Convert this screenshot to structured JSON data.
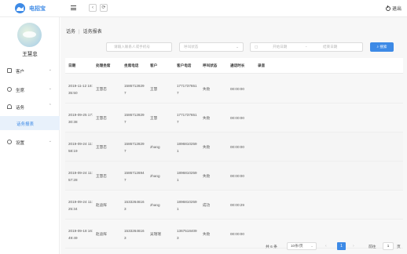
{
  "app": {
    "logo_text": "电招宝",
    "logout_label": "退出"
  },
  "toolbar": {
    "back_glyph": "‹",
    "refresh_glyph": "⟳"
  },
  "user": {
    "name": "王慧忠"
  },
  "sidebar": {
    "items": [
      {
        "label": "客户",
        "icon": "user-icon",
        "chevron": "⌄"
      },
      {
        "label": "坐席",
        "icon": "person-icon",
        "chevron": "⌄"
      },
      {
        "label": "话务",
        "icon": "headset-icon",
        "chevron": "⌃"
      },
      {
        "label": "设置",
        "icon": "gear-icon",
        "chevron": "⌄"
      }
    ],
    "active_sub": "话务报表"
  },
  "breadcrumb": {
    "parent": "话务",
    "separator": "|",
    "current": "话务报表"
  },
  "filters": {
    "keyword_placeholder": "请输入联系人或手机号",
    "status_placeholder": "呼叫状态",
    "start_placeholder": "开始日期",
    "range_sep": "-",
    "end_placeholder": "结束日期",
    "search_label": "搜索"
  },
  "table": {
    "columns": [
      "日期",
      "处理坐席",
      "坐席电话",
      "客户",
      "客户电话",
      "呼叫状态",
      "通话时长",
      "录音"
    ],
    "rows": [
      {
        "date": "2019-11-12 18:35:50",
        "agent": "王慧忠",
        "agent_phone": "15867128297",
        "customer": "王慧",
        "customer_phone": "17717376517",
        "status": "失败",
        "duration": "00:00:00",
        "recording": ""
      },
      {
        "date": "2019-09-25 17:30:38",
        "agent": "王慧忠",
        "agent_phone": "15867128297",
        "customer": "王慧",
        "customer_phone": "17717376517",
        "status": "失败",
        "duration": "00:00:00",
        "recording": ""
      },
      {
        "date": "2019-09-24 11:58:19",
        "agent": "王慧忠",
        "agent_phone": "15867128297",
        "customer": "zhang",
        "customer_phone": "18968102591",
        "status": "失败",
        "duration": "00:00:00",
        "recording": ""
      },
      {
        "date": "2019-09-24 11:57:28",
        "agent": "王慧忠",
        "agent_phone": "15867126947",
        "customer": "zhang",
        "customer_phone": "18968102591",
        "status": "失败",
        "duration": "00:00:00",
        "recording": ""
      },
      {
        "date": "2019-09-24 11:25:34",
        "agent": "赵迪辉",
        "agent_phone": "15332646163",
        "customer": "zhang",
        "customer_phone": "18968102591",
        "status": "成功",
        "duration": "00:00:29",
        "recording": ""
      },
      {
        "date": "2019-09-18 16:49:49",
        "agent": "赵迪辉",
        "agent_phone": "15332646163",
        "customer": "吴瑞瑞",
        "customer_phone": "13675184093",
        "status": "失败",
        "duration": "00:00:00",
        "recording": ""
      }
    ]
  },
  "pagination": {
    "total_label": "共 6 条",
    "page_size": "10条/页",
    "prev_glyph": "‹",
    "current_page": "1",
    "next_glyph": "›",
    "goto_label": "前往",
    "goto_value": "1",
    "unit_label": "页"
  },
  "colors": {
    "accent": "#3d8ae6",
    "active_bg": "#e8f1fb"
  }
}
